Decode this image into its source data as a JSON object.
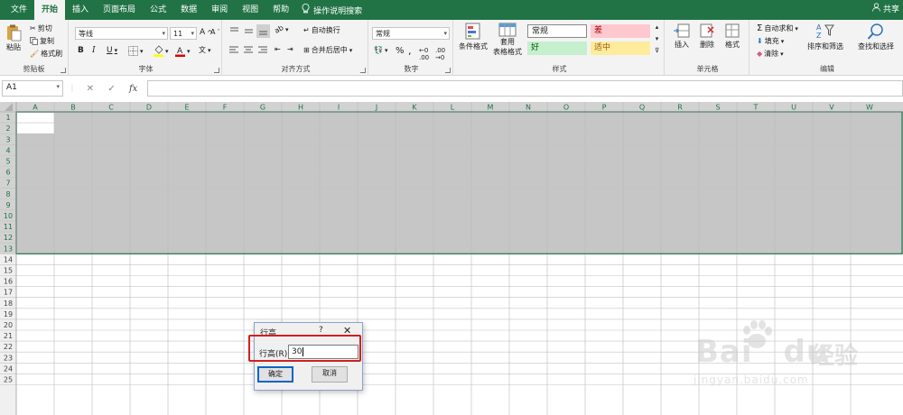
{
  "tabs": [
    "文件",
    "开始",
    "插入",
    "页面布局",
    "公式",
    "数据",
    "审阅",
    "视图",
    "帮助"
  ],
  "active_tab": "开始",
  "tell_me": "操作说明搜索",
  "share_label": "共享",
  "clipboard": {
    "paste": "粘贴",
    "cut": "剪切",
    "copy": "复制",
    "format_painter": "格式刷",
    "label": "剪贴板"
  },
  "font": {
    "name": "等线",
    "size": "11",
    "bold": "B",
    "italic": "I",
    "underline": "U",
    "label": "字体"
  },
  "alignment": {
    "wrap": "自动换行",
    "merge": "合并后居中",
    "label": "对齐方式"
  },
  "number": {
    "format": "常规",
    "percent": "%",
    "comma": ",",
    "label": "数字"
  },
  "styles": {
    "conditional": "条件格式",
    "table": "套用",
    "table2": "表格格式",
    "normal": "常规",
    "bad": "差",
    "good": "好",
    "neutral": "适中",
    "label": "样式",
    "colors": {
      "bad_bg": "#ffc7ce",
      "bad_fg": "#9c0006",
      "good_bg": "#c6efce",
      "good_fg": "#006100",
      "neutral_bg": "#ffeb9c",
      "neutral_fg": "#9c5700"
    }
  },
  "cells": {
    "insert": "插入",
    "delete": "删除",
    "format": "格式",
    "label": "单元格"
  },
  "editing": {
    "autosum": "自动求和",
    "fill": "填充",
    "clear": "清除",
    "sort": "排序和筛选",
    "find": "查找和选择",
    "label": "编辑"
  },
  "formula_bar": {
    "name_box": "A1",
    "fx": "fx",
    "value": ""
  },
  "columns": [
    "A",
    "B",
    "C",
    "D",
    "E",
    "F",
    "G",
    "H",
    "I",
    "J",
    "K",
    "L",
    "M",
    "N",
    "O",
    "P",
    "Q",
    "R",
    "S",
    "T",
    "U",
    "V",
    "W"
  ],
  "rows": [
    "1",
    "2",
    "3",
    "4",
    "5",
    "6",
    "7",
    "8",
    "9",
    "10",
    "11",
    "12",
    "13",
    "14",
    "15",
    "16",
    "17",
    "18",
    "19",
    "20",
    "21",
    "22",
    "23",
    "24",
    "25"
  ],
  "selected_rows": 13,
  "dialog": {
    "title": "行高",
    "help": "?",
    "close": "✕",
    "label": "行高(R):",
    "value": "30",
    "ok": "确定",
    "cancel": "取消"
  },
  "watermark": {
    "brand": "Bai",
    "brand2": "du",
    "cn": "经验",
    "url": "jingyan.baidu.com"
  },
  "accent": "#217346"
}
